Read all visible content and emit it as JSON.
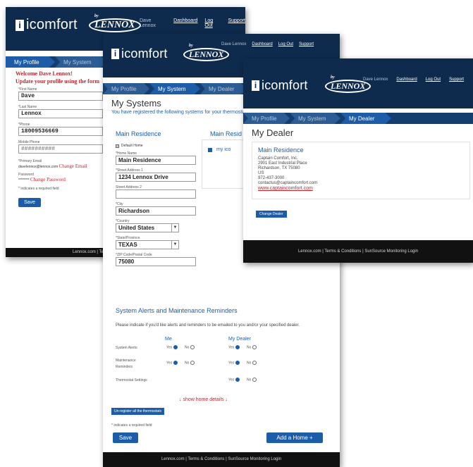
{
  "brand": {
    "name": "icomfort",
    "by": "by",
    "lennox": "LENNOX"
  },
  "nav": {
    "user": "Dave Lennox",
    "dashboard": "Dashboard",
    "logout": "Log Out",
    "support": "Support"
  },
  "tabs": {
    "profile": "My Profile",
    "system": "My System",
    "dealer": "My Dealer"
  },
  "footer": "Lennox.com | Terms & Conditions | SunSource Monitoring Login",
  "footer_short": "Lennox.com | Ter",
  "profile": {
    "welcome": "Welcome Dave Lennox!",
    "update": "Update your profile using the form",
    "first_label": "*First Name",
    "first_value": "Dave",
    "last_label": "*Last Name",
    "last_value": "Lennox",
    "phone_label": "*Phone",
    "phone_value": "18009536669",
    "mobile_label": "Mobile Phone",
    "mobile_value": "##########",
    "email_label": "*Primary Email",
    "email_value": "davelennox@lennox.com",
    "change_email": "Change Email",
    "password_label": "Password",
    "password_value": "********",
    "change_password": "Change Password",
    "required": "* indicates a required field",
    "save": "Save"
  },
  "systems": {
    "title": "My Systems",
    "intro": "You have registered the following systems for your thermostat",
    "home_title": "Main Residence",
    "home_title2": "Main Resid",
    "default_home": "Default Home",
    "home_name_label": "*Home Name",
    "home_name_value": "Main Residence",
    "street1_label": "*Street Address 1",
    "street1_value": "1234 Lennox Drive",
    "street2_label": "Street Address 2",
    "street2_value": "",
    "city_label": "*City",
    "city_value": "Richardson",
    "country_label": "*Country",
    "country_value": "United States",
    "state_label": "*State/Province",
    "state_value": "TEXAS",
    "zip_label": "*ZIP Code/Postal Code",
    "zip_value": "75080",
    "side_item": "my ico",
    "alerts_title": "System Alerts and Maintenance Reminders",
    "alerts_intro": "Please indicate if you'd like alerts and reminders to be emailed to you and/or your specified dealer.",
    "col_me": "Me",
    "col_dealer": "My Dealer",
    "yes": "Yes",
    "no": "No",
    "rows": [
      {
        "label": "System Alerts"
      },
      {
        "label": "Maintenance Reminders"
      },
      {
        "label": "Thermostat Settings"
      }
    ],
    "show_details": "show home details",
    "unregister": "Un-register all the thermostats",
    "required": "* indicates a required field",
    "save": "Save",
    "add_home": "Add a Home +"
  },
  "dealer": {
    "title": "My Dealer",
    "home": "Main Residence",
    "name": "Captain Comfort, Inc.",
    "address1": "2901 East Industrial Place",
    "address2": "Richardson, TX 75080",
    "country": "US",
    "phone": "972-437-3000",
    "email": "contactus@captaincomfort.com",
    "website": "www.captaincomfort.com",
    "change": "Change Dealer"
  }
}
